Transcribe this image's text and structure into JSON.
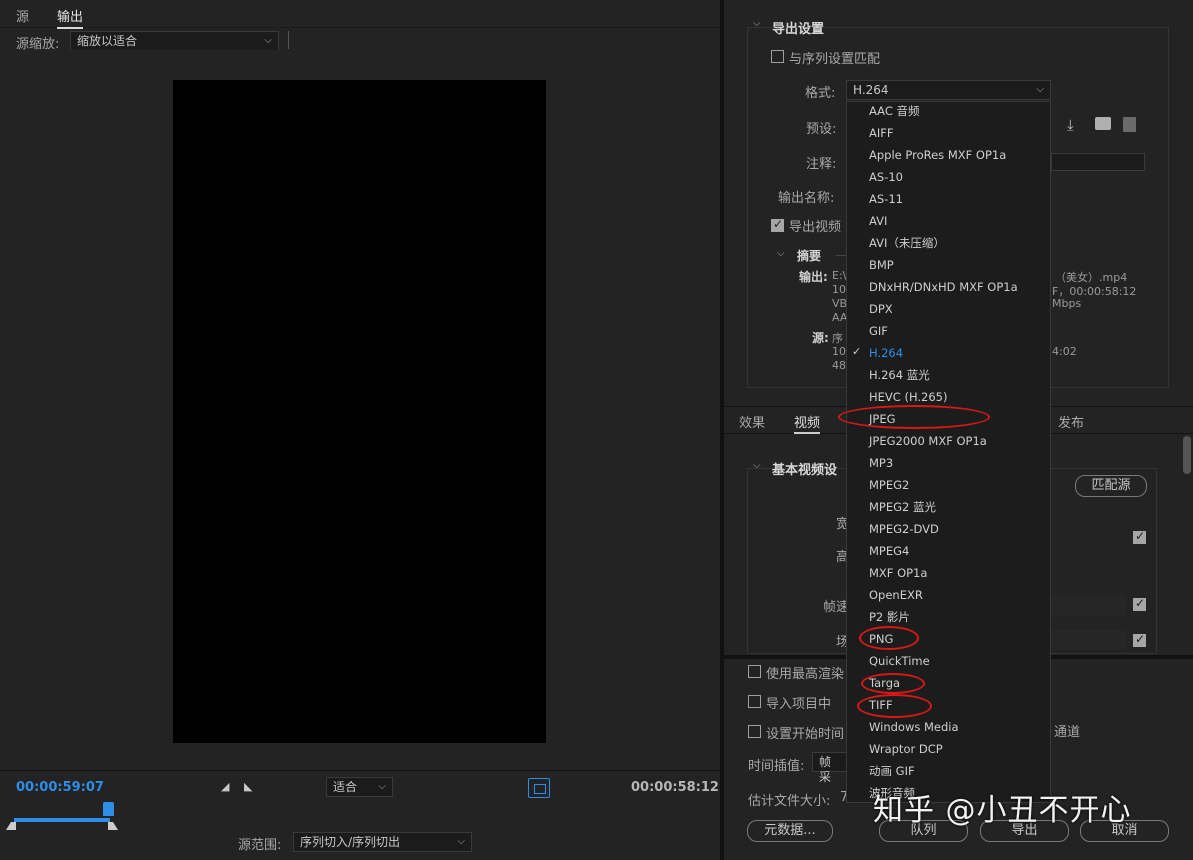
{
  "left": {
    "tabs": [
      "源",
      "输出"
    ],
    "source_scale_label": "源缩放:",
    "source_scale_value": "缩放以适合",
    "timecode_current": "00:00:59:07",
    "timecode_duration": "00:00:58:12",
    "zoom_value": "适合",
    "source_range_label": "源范围:",
    "source_range_value": "序列切入/序列切出"
  },
  "export_settings": {
    "title": "导出设置",
    "match_sequence_label": "与序列设置匹配",
    "format_label": "格式:",
    "format_value": "H.264",
    "preset_label": "预设:",
    "comment_label": "注释:",
    "output_name_label": "输出名称:",
    "export_video_label": "导出视频",
    "summary_title": "摘要",
    "summary_output_label": "输出:",
    "summary_output_lines": [
      "E:\\",
      "108",
      "VB",
      "AA"
    ],
    "summary_output_right": [
      "（美女）.mp4",
      "F，00:00:58:12",
      "Mbps"
    ],
    "summary_source_label": "源:",
    "summary_source_lines": [
      "序",
      "108",
      "480"
    ],
    "summary_source_right": [
      "4:02"
    ]
  },
  "tabs2": {
    "effects": "效果",
    "video": "视频",
    "publish": "发布"
  },
  "basic_video": {
    "title": "基本视频设",
    "match_source_button": "匹配源",
    "width_label": "宽",
    "height_label": "高",
    "frame_rate_label": "帧速",
    "field_label": "场"
  },
  "bottom_options": {
    "max_render_label": "使用最高渲染",
    "import_project_label": "导入项目中",
    "set_start_time_label": "设置开始时间",
    "channel_suffix": "通道",
    "time_interp_label": "时间插值:",
    "time_interp_value": "帧采",
    "est_size_label": "估计文件大小:",
    "est_size_value": "7",
    "metadata_button": "元数据...",
    "queue_button": "队列",
    "export_button": "导出",
    "cancel_button": "取消"
  },
  "format_dropdown": {
    "items": [
      "AAC 音频",
      "AIFF",
      "Apple ProRes MXF OP1a",
      "AS-10",
      "AS-11",
      "AVI",
      "AVI（未压缩）",
      "BMP",
      "DNxHR/DNxHD MXF OP1a",
      "DPX",
      "GIF",
      "H.264",
      "H.264 蓝光",
      "HEVC (H.265)",
      "JPEG",
      "JPEG2000 MXF OP1a",
      "MP3",
      "MPEG2",
      "MPEG2 蓝光",
      "MPEG2-DVD",
      "MPEG4",
      "MXF OP1a",
      "OpenEXR",
      "P2 影片",
      "PNG",
      "QuickTime",
      "Targa",
      "TIFF",
      "Windows Media",
      "Wraptor DCP",
      "动画 GIF",
      "波形音频"
    ],
    "selected": "H.264",
    "circled": [
      "JPEG",
      "PNG",
      "Targa",
      "TIFF"
    ]
  },
  "watermark": "知乎 @小丑不开心",
  "colors": {
    "accent": "#2e8de6",
    "annotation": "#d61818",
    "panel": "#232323"
  }
}
